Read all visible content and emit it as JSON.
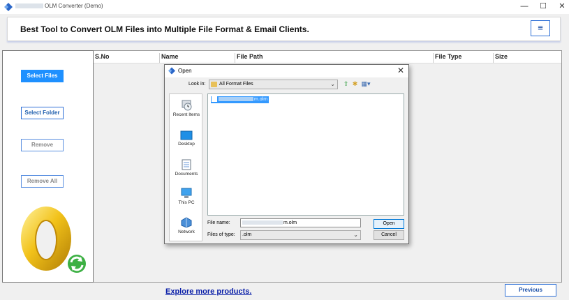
{
  "window": {
    "title": "OLM Converter (Demo)",
    "minimize_glyph": "—",
    "maximize_glyph": "☐",
    "close_glyph": "✕"
  },
  "header": {
    "title": "Best Tool to Convert OLM Files into Multiple File Format & Email Clients.",
    "menu_glyph": "≡"
  },
  "sidebar": {
    "select_files": "Select Files",
    "select_folder": "Select Folder",
    "remove": "Remove",
    "remove_all": "Remove All"
  },
  "table": {
    "columns": [
      "S.No",
      "Name",
      "File Path",
      "File Type",
      "Size"
    ]
  },
  "footer": {
    "explore_link": "Explore more products.",
    "previous": "Previous"
  },
  "dialog": {
    "title": "Open",
    "close_glyph": "✕",
    "look_in_label": "Look in:",
    "look_in_value": "All Format Files",
    "places": [
      {
        "label": "Recent Items",
        "icon": "recent-items-icon"
      },
      {
        "label": "Desktop",
        "icon": "desktop-icon"
      },
      {
        "label": "Documents",
        "icon": "documents-icon"
      },
      {
        "label": "This PC",
        "icon": "this-pc-icon"
      },
      {
        "label": "Network",
        "icon": "network-icon"
      }
    ],
    "file_item_suffix": "m.olm",
    "file_name_label": "File name:",
    "file_name_suffix": "m.olm",
    "file_type_label": "Files of type:",
    "file_type_value": ".olm",
    "open_button": "Open",
    "cancel_button": "Cancel"
  },
  "colors": {
    "accent": "#1e90ff",
    "button_border": "#2d6fd6",
    "link": "#0a1fa8",
    "selection": "#3399ff"
  }
}
